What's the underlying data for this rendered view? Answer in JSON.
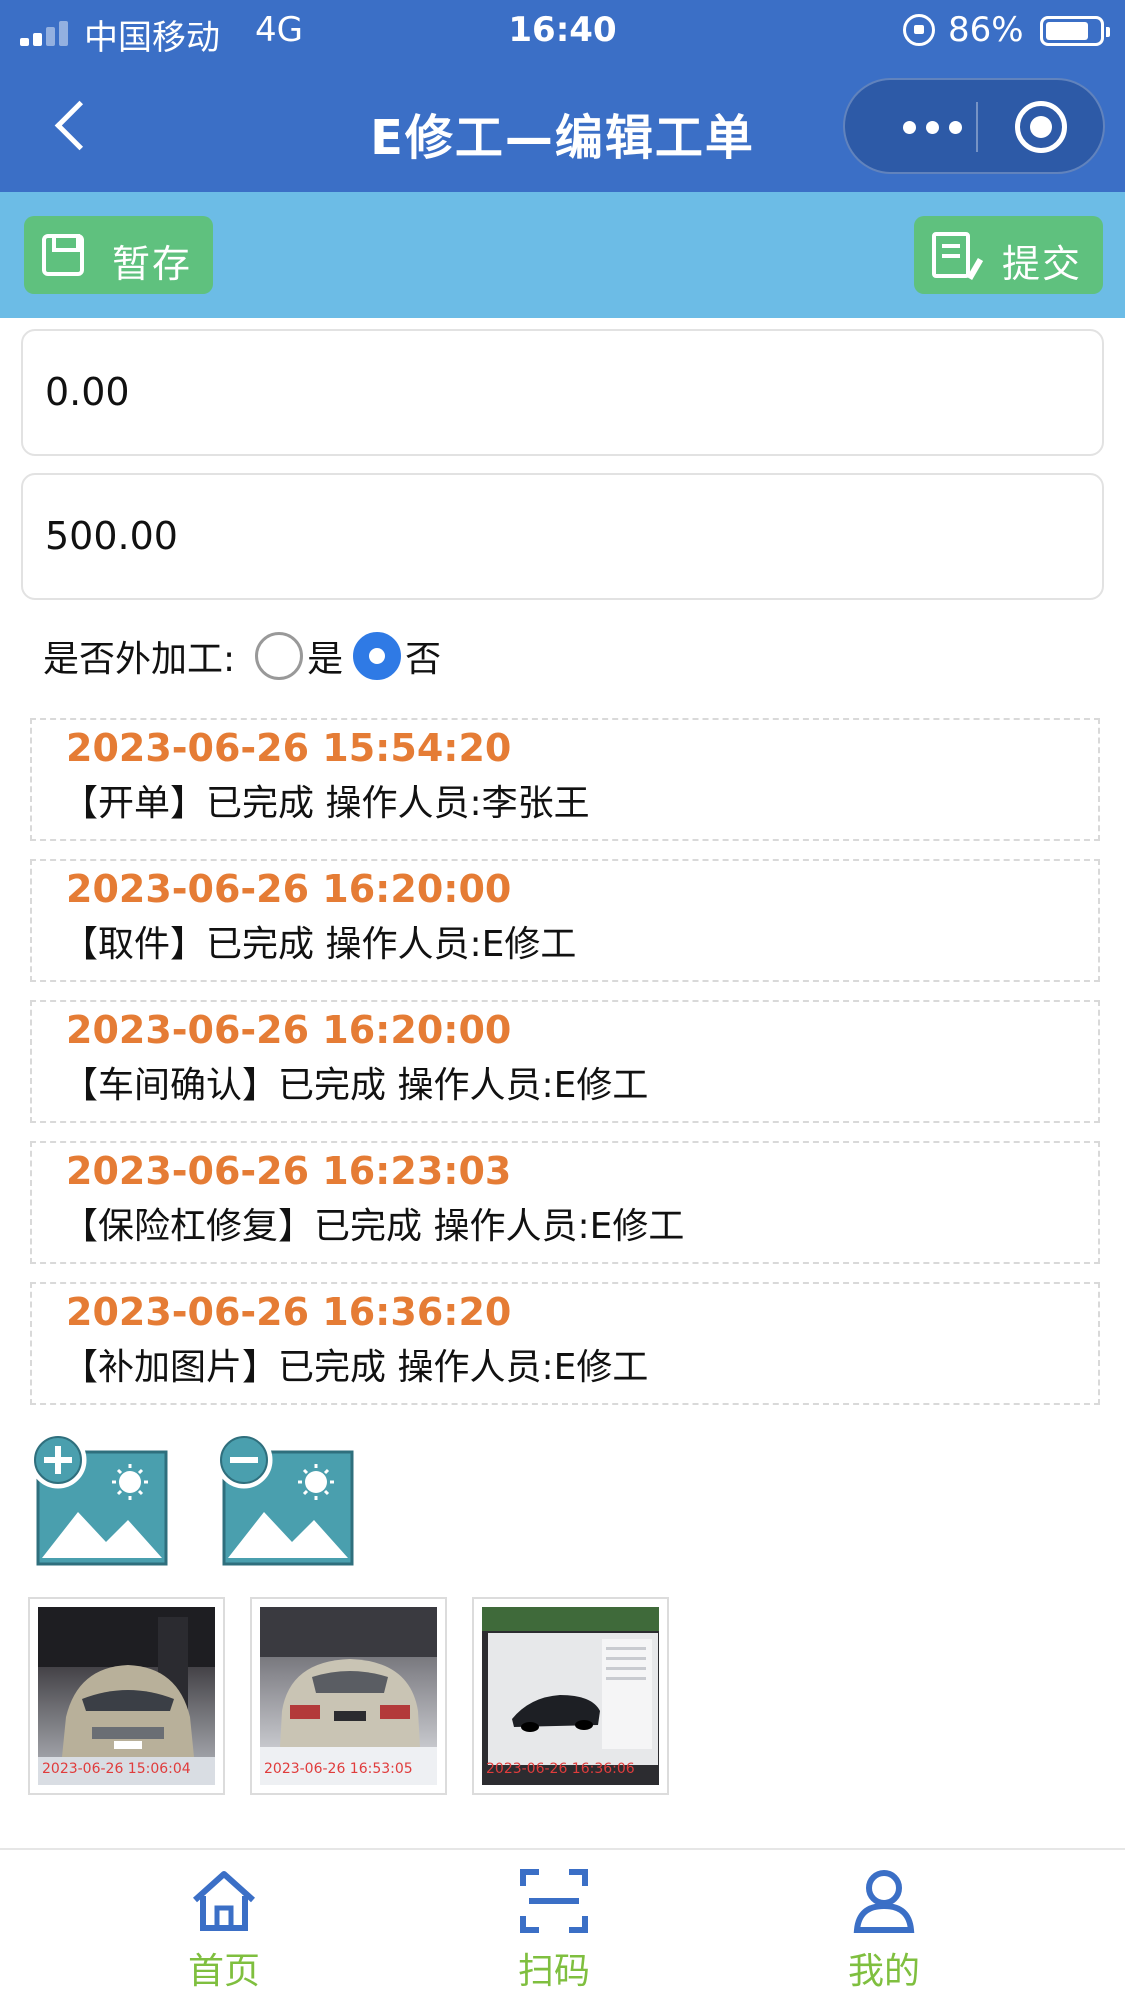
{
  "status_bar": {
    "carrier": "中国移动",
    "network": "4G",
    "time": "16:40",
    "battery": "86%"
  },
  "nav": {
    "title": "E修工—编辑工单"
  },
  "toolbar": {
    "save_label": "暂存",
    "submit_label": "提交"
  },
  "fields": {
    "field1_value": "0.00",
    "field2_value": "500.00"
  },
  "outsourcing": {
    "question": "是否外加工:",
    "options": [
      "是",
      "否"
    ],
    "selected": "否"
  },
  "logs": [
    {
      "time": "2023-06-26 15:54:20",
      "text": "【开单】已完成 操作人员:李张王"
    },
    {
      "time": "2023-06-26 16:20:00",
      "text": "【取件】已完成 操作人员:E修工"
    },
    {
      "time": "2023-06-26 16:20:00",
      "text": "【车间确认】已完成 操作人员:E修工"
    },
    {
      "time": "2023-06-26 16:23:03",
      "text": "【保险杠修复】已完成 操作人员:E修工"
    },
    {
      "time": "2023-06-26 16:36:20",
      "text": "【补加图片】已完成 操作人员:E修工"
    }
  ],
  "image_tools": {
    "add_icon": "add-image-icon",
    "remove_icon": "remove-image-icon"
  },
  "photos": [
    {
      "stamp": "2023-06-26 15:06:04"
    },
    {
      "stamp": "2023-06-26 16:53:05"
    },
    {
      "stamp": "2023-06-26 16:36:06"
    }
  ],
  "tabbar": {
    "items": [
      {
        "label": "首页",
        "icon": "home-icon"
      },
      {
        "label": "扫码",
        "icon": "scan-icon"
      },
      {
        "label": "我的",
        "icon": "profile-icon"
      }
    ]
  },
  "colors": {
    "nav_bg": "#3b6fc6",
    "toolbar_bg": "#6cbce6",
    "button_green": "#5fc17e",
    "log_time_orange": "#e57c35",
    "radio_blue": "#2f7ae5",
    "tab_green": "#7fbf3f"
  }
}
